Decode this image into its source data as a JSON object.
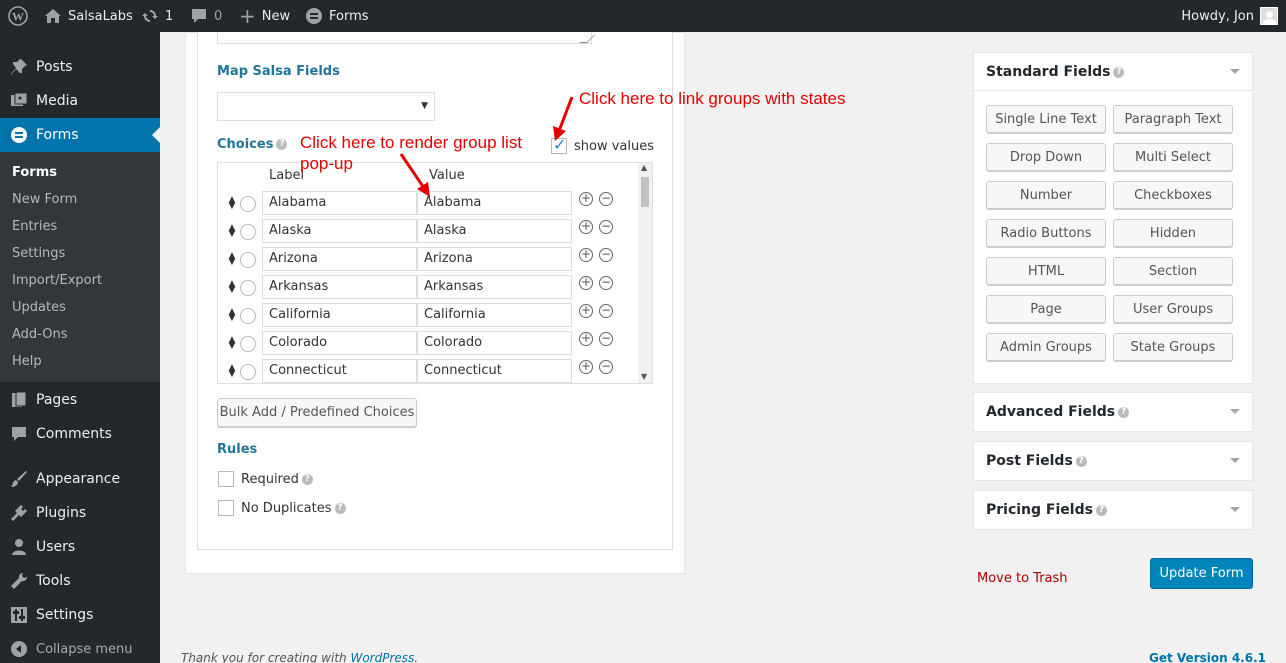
{
  "adminbar": {
    "site_name": "SalsaLabs",
    "updates_count": "1",
    "comments_count": "0",
    "new_label": "New",
    "forms_label": "Forms",
    "howdy": "Howdy, Jon"
  },
  "sidebar": {
    "posts": "Posts",
    "media": "Media",
    "forms": "Forms",
    "sub_forms": "Forms",
    "sub_new_form": "New Form",
    "sub_entries": "Entries",
    "sub_settings": "Settings",
    "sub_import_export": "Import/Export",
    "sub_updates": "Updates",
    "sub_addons": "Add-Ons",
    "sub_help": "Help",
    "pages": "Pages",
    "comments": "Comments",
    "appearance": "Appearance",
    "plugins": "Plugins",
    "users": "Users",
    "tools": "Tools",
    "settings": "Settings",
    "collapse": "Collapse menu"
  },
  "field_settings": {
    "map_salsa_label": "Map Salsa Fields",
    "choices_label": "Choices",
    "show_values_label": "show values",
    "show_values_checked": true,
    "col_label": "Label",
    "col_value": "Value",
    "choices": [
      {
        "label": "Alabama",
        "value": "Alabama"
      },
      {
        "label": "Alaska",
        "value": "Alaska"
      },
      {
        "label": "Arizona",
        "value": "Arizona"
      },
      {
        "label": "Arkansas",
        "value": "Arkansas"
      },
      {
        "label": "California",
        "value": "California"
      },
      {
        "label": "Colorado",
        "value": "Colorado"
      },
      {
        "label": "Connecticut",
        "value": "Connecticut"
      }
    ],
    "bulk_add_label": "Bulk Add / Predefined Choices",
    "rules_label": "Rules",
    "required_label": "Required",
    "no_duplicates_label": "No Duplicates"
  },
  "annotations": {
    "link_groups": "Click here to link groups with states",
    "render_group_line1": "Click here to render group list",
    "render_group_line2": "pop-up",
    "color": "#e50000"
  },
  "standard_fields": {
    "title": "Standard Fields",
    "buttons": [
      "Single Line Text",
      "Paragraph Text",
      "Drop Down",
      "Multi Select",
      "Number",
      "Checkboxes",
      "Radio Buttons",
      "Hidden",
      "HTML",
      "Section",
      "Page",
      "User Groups",
      "Admin Groups",
      "State Groups"
    ]
  },
  "advanced_fields": {
    "title": "Advanced Fields"
  },
  "post_fields": {
    "title": "Post Fields"
  },
  "pricing_fields": {
    "title": "Pricing Fields"
  },
  "actions": {
    "trash": "Move to Trash",
    "update": "Update Form"
  },
  "footer": {
    "thanks_prefix": "Thank you for creating with ",
    "wordpress_link": "WordPress",
    "thanks_suffix": ".",
    "version": "Get Version 4.6.1"
  },
  "colors": {
    "accent": "#0073aa",
    "primary_button": "#0085ba",
    "adminbar": "#23282d",
    "trash": "#a00"
  }
}
